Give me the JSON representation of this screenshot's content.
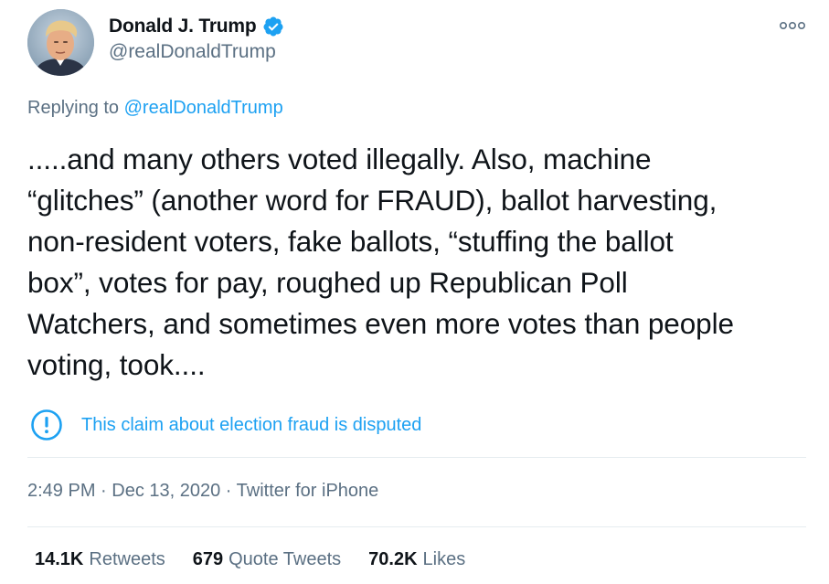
{
  "author": {
    "name": "Donald J. Trump",
    "handle": "@realDonaldTrump",
    "verified_icon": "verified-badge-icon",
    "avatar_icon": "profile-photo"
  },
  "more_icon": "more-options-icon",
  "reply": {
    "prefix": "Replying to ",
    "mention": "@realDonaldTrump"
  },
  "tweet_text": ".....and many others voted illegally. Also, machine\n“glitches” (another word for FRAUD), ballot harvesting,\nnon-resident voters, fake ballots, “stuffing the ballot\nbox”, votes for pay, roughed up Republican Poll\nWatchers, and sometimes even more votes than people\nvoting, took....",
  "notice": {
    "icon": "exclamation-circle-icon",
    "text": "This claim about election fraud is disputed"
  },
  "meta": {
    "time": "2:49 PM",
    "separator1": " · ",
    "date": "Dec 13, 2020",
    "separator2": " · ",
    "source": "Twitter for iPhone"
  },
  "stats": {
    "retweets_count": "14.1K",
    "retweets_label": "Retweets",
    "quotes_count": "679",
    "quotes_label": "Quote Tweets",
    "likes_count": "70.2K",
    "likes_label": "Likes"
  },
  "colors": {
    "accent": "#1da1f2",
    "secondary_text": "#5b7083",
    "primary_text": "#0f1419",
    "divider": "#e6ecf0"
  }
}
